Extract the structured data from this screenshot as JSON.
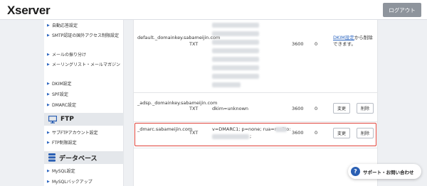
{
  "header": {
    "logo": "Xserver",
    "logout_label": "ログアウト"
  },
  "sidebar": {
    "items_top": [
      "自動応答設定",
      "SMTP認証の国外アクセス制限設定",
      "メールの振り分け",
      "メーリングリスト・メールマガジン",
      "DKIM設定",
      "SPF設定",
      "DMARC設定"
    ],
    "ftp_section": "FTP",
    "ftp_items": [
      "サブFTPアカウント設定",
      "FTP制限設定"
    ],
    "db_section": "データベース",
    "db_items": [
      "MySQL設定",
      "MySQLバックアップ"
    ]
  },
  "table": {
    "rows": [
      {
        "host": "default._domainkey.sabameijin.com",
        "type": "TXT",
        "content": "",
        "ttl": "3600",
        "priority": "0",
        "note_link": "DKIM設定",
        "note_text": "から削除できます。"
      },
      {
        "host": "_adsp._domainkey.sabameijin.com",
        "type": "TXT",
        "content": "dkim=unknown",
        "ttl": "3600",
        "priority": "0",
        "edit_label": "変更",
        "delete_label": "削除"
      },
      {
        "host": "_dmarc.sabameijin.com",
        "type": "TXT",
        "content": "v=DMARC1; p=none; rua=mailto:",
        "content_tail": ";",
        "ttl": "3600",
        "priority": "0",
        "edit_label": "変更",
        "delete_label": "削除"
      }
    ]
  },
  "support_label": "サポート・お問い合わせ"
}
